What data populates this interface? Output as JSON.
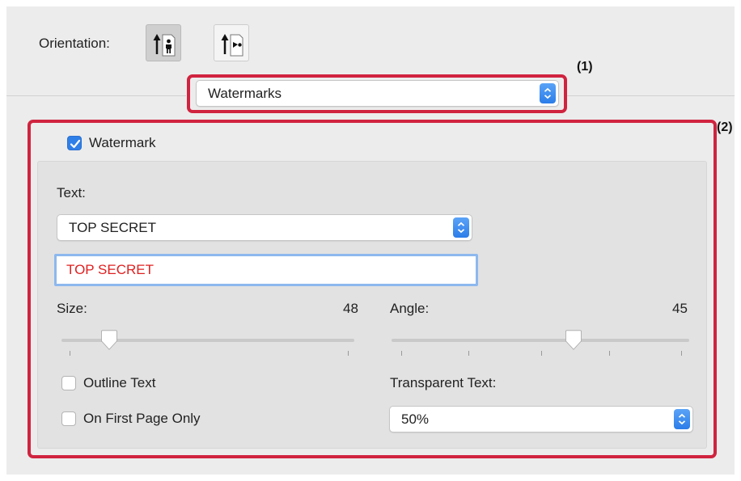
{
  "orientation": {
    "label": "Orientation:",
    "options": [
      {
        "icon": "portrait-person-icon",
        "selected": true
      },
      {
        "icon": "landscape-person-icon",
        "selected": false
      }
    ]
  },
  "callouts": {
    "one": "(1)",
    "two": "(2)"
  },
  "panel_select": {
    "value": "Watermarks"
  },
  "watermark": {
    "checkbox_label": "Watermark",
    "checked": true,
    "text_label": "Text:",
    "text_select": "TOP SECRET",
    "text_field_value": "TOP SECRET",
    "size_label": "Size:",
    "size_value": "48",
    "angle_label": "Angle:",
    "angle_value": "45",
    "outline_label": "Outline Text",
    "outline_checked": false,
    "first_page_label": "On First Page Only",
    "first_page_checked": false,
    "transparent_label": "Transparent Text:",
    "transparent_value": "50%"
  },
  "colors": {
    "accent": "#2f7fe8",
    "highlight_frame": "#d0233f",
    "watermark_text": "#e02020"
  }
}
